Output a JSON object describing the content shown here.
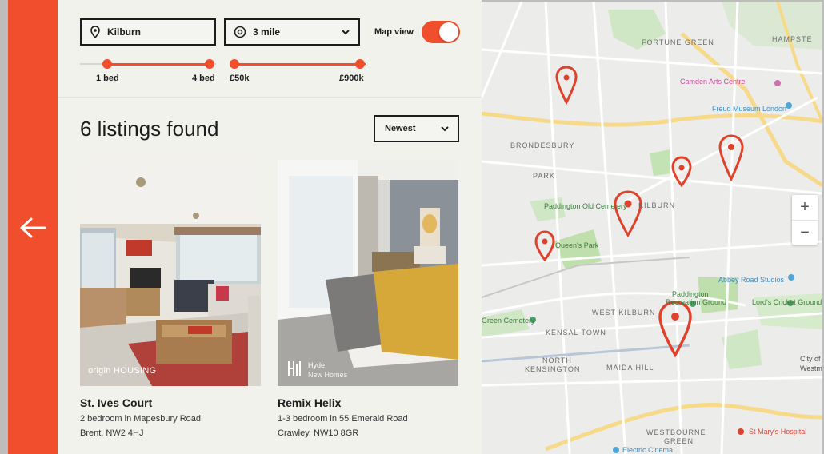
{
  "filters": {
    "location_value": "Kilburn",
    "radius_value": "3 mile",
    "map_view_label": "Map view",
    "map_view_on": true,
    "beds_min_label": "1 bed",
    "beds_max_label": "4 bed",
    "price_min_label": "£50k",
    "price_max_label": "£900k"
  },
  "results": {
    "count_label": "6 listings found",
    "sort_value": "Newest"
  },
  "listings": [
    {
      "title": "St. Ives Court",
      "line1": "2 bedroom in Mapesbury Road",
      "line2": "Brent, NW2 4HJ",
      "brand": "origin HOUSING"
    },
    {
      "title": "Remix Helix",
      "line1": "1-3 bedroom in 55 Emerald Road",
      "line2": "Crawley, NW10 8GR",
      "brand_top": "Hyde",
      "brand_bottom": "New Homes"
    }
  ],
  "map": {
    "labels": {
      "fortune_green": "FORTUNE GREEN",
      "hampstead": "HAMPSTE",
      "camden_arts": "Camden Arts Centre",
      "freud": "Freud Museum London",
      "brondesbury": "BRONDESBURY",
      "park": "PARK",
      "paddington_old": "Paddington Old Cemetery",
      "kilburn": "KILBURN",
      "queens_park": "Queen's Park",
      "abbey_road": "Abbey Road Studios",
      "paddington_rec": "Paddington",
      "recreation": "Recreation Ground",
      "lords": "Lord's Cricket Ground",
      "west_kilburn": "WEST KILBURN",
      "cemetery": "Green Cemetery",
      "kensal_town": "KENSAL TOWN",
      "north": "NORTH",
      "kensington": "KENSINGTON",
      "maida_hill": "MAIDA HILL",
      "westbourne": "WESTBOURNE",
      "green": "GREEN",
      "st_marys": "St Mary's Hospital",
      "electric_cinema": "Electric Cinema",
      "city": "City of",
      "westm": "Westm"
    },
    "zoom_in": "+",
    "zoom_out": "−"
  },
  "colors": {
    "accent": "#f04e2d",
    "panel_bg": "#f2f2ed",
    "map_bg": "#ececea",
    "pin": "#e0412b"
  },
  "icons": {
    "back": "arrow-left-icon",
    "location": "map-pin-icon",
    "radius": "target-icon",
    "chevron": "chevron-down-icon"
  }
}
